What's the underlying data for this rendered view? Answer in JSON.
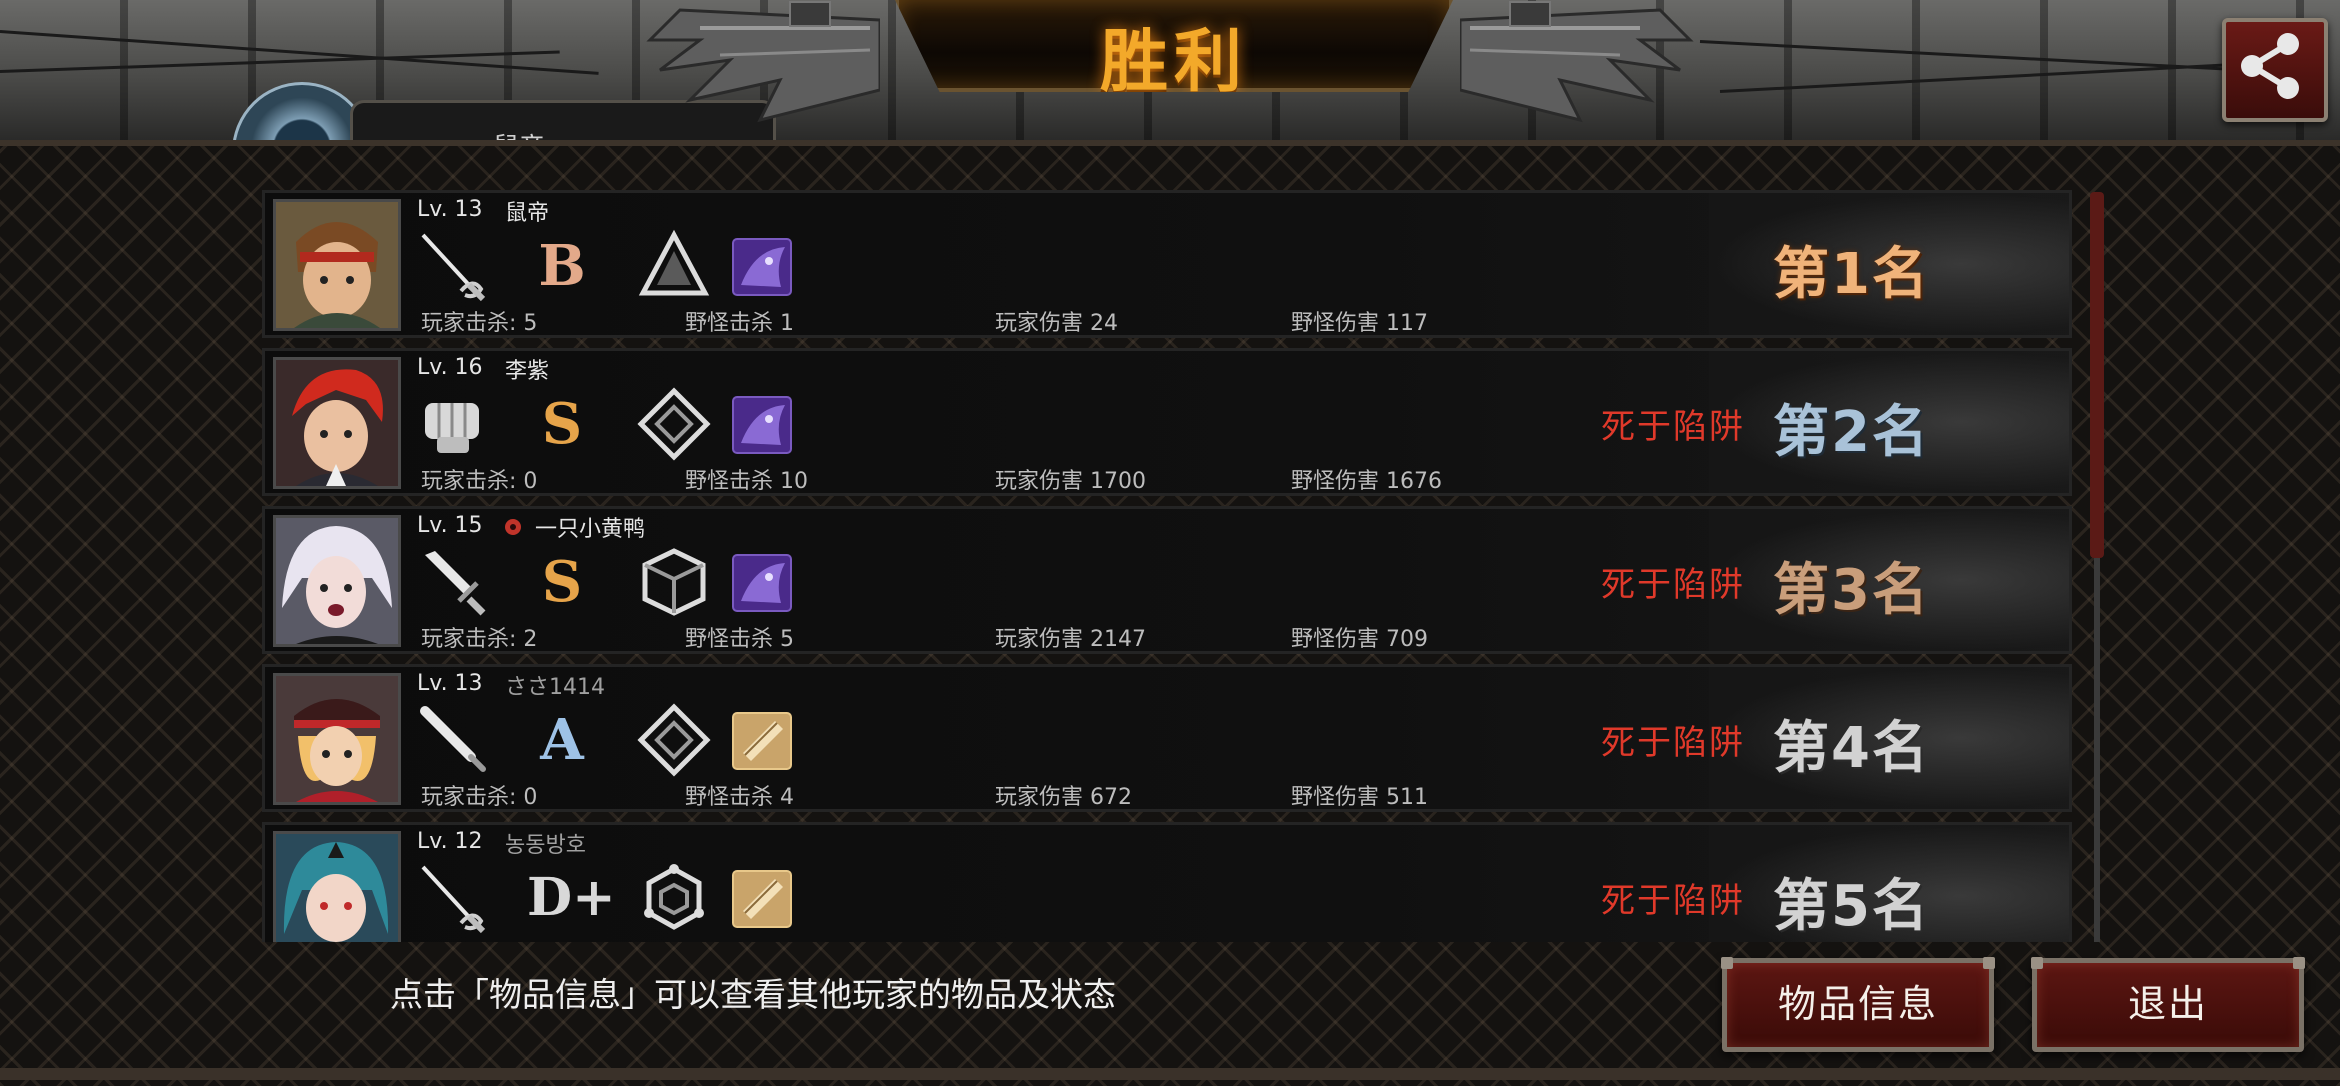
{
  "header": {
    "title": "胜利",
    "player_tab_name": "鼠帝"
  },
  "players": [
    {
      "level": "Lv. 13",
      "name": "鼠帝",
      "grade": "B",
      "stats": {
        "player_kills": "玩家击杀: 5",
        "monster_kills": "野怪击杀 1",
        "player_damage": "玩家伤害 24",
        "monster_damage": "野怪伤害 117"
      },
      "death": "",
      "rank": "第1名",
      "rank_color": "#f0b37a"
    },
    {
      "level": "Lv. 16",
      "name": "李紫",
      "grade": "S",
      "stats": {
        "player_kills": "玩家击杀: 0",
        "monster_kills": "野怪击杀 10",
        "player_damage": "玩家伤害 1700",
        "monster_damage": "野怪伤害 1676"
      },
      "death": "死于陷阱",
      "rank": "第2名",
      "rank_color": "#a9c2d8"
    },
    {
      "level": "Lv. 15",
      "name": "一只小黄鸭",
      "grade": "S",
      "stats": {
        "player_kills": "玩家击杀: 2",
        "monster_kills": "野怪击杀 5",
        "player_damage": "玩家伤害 2147",
        "monster_damage": "野怪伤害 709"
      },
      "death": "死于陷阱",
      "rank": "第3名",
      "rank_color": "#c99e7b"
    },
    {
      "level": "Lv. 13",
      "name": "ささ1414",
      "grade": "A",
      "stats": {
        "player_kills": "玩家击杀: 0",
        "monster_kills": "野怪击杀 4",
        "player_damage": "玩家伤害 672",
        "monster_damage": "野怪伤害 511"
      },
      "death": "死于陷阱",
      "rank": "第4名",
      "rank_color": "#d2d2d2"
    },
    {
      "level": "Lv. 12",
      "name": "농동방호",
      "grade": "D+",
      "stats": {
        "player_kills": "",
        "monster_kills": "",
        "player_damage": "",
        "monster_damage": ""
      },
      "death": "死于陷阱",
      "rank": "第5名",
      "rank_color": "#d2d2d2"
    }
  ],
  "footer": {
    "hint": "点击「物品信息」可以查看其他玩家的物品及状态",
    "item_info_button": "物品信息",
    "exit_button": "退出"
  },
  "icons": {
    "weapons": [
      "rapier-icon",
      "fist-icon",
      "dagger-icon",
      "bat-icon",
      "rapier-icon"
    ],
    "skills": [
      "triangle-skill-icon",
      "diamond-skill-icon",
      "cube-skill-icon",
      "diamond-skill-icon",
      "hexagon-skill-icon"
    ],
    "items": [
      "purple-beast-item-icon",
      "purple-beast-item-icon",
      "purple-beast-item-icon",
      "gold-scroll-item-icon",
      "gold-scroll-item-icon"
    ]
  },
  "colors": {
    "title": "#f3a92a",
    "death_text": "#e0392a",
    "button_bg": "#5c1612"
  }
}
